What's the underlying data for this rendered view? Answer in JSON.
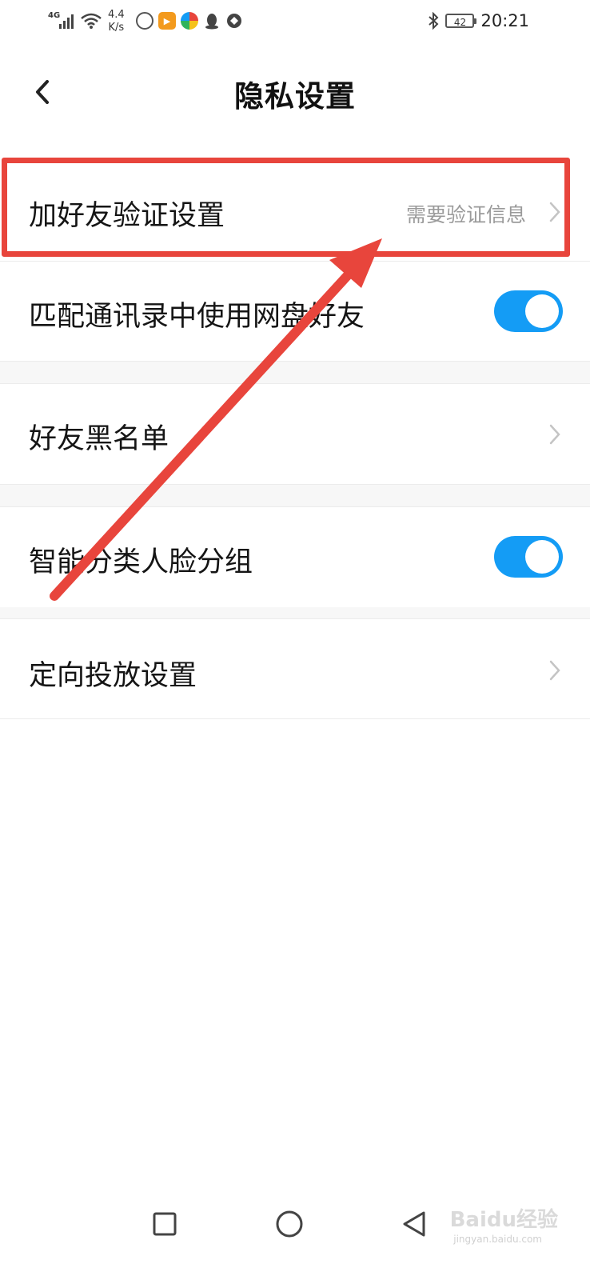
{
  "status_bar": {
    "network": "4G",
    "speed_value": "4.4",
    "speed_unit": "K/s",
    "battery": "42",
    "time": "20:21"
  },
  "header": {
    "title": "隐私设置"
  },
  "settings": {
    "friend_verification": {
      "label": "加好友验证设置",
      "value": "需要验证信息"
    },
    "match_contacts": {
      "label": "匹配通讯录中使用网盘好友",
      "enabled": true
    },
    "blacklist": {
      "label": "好友黑名单"
    },
    "face_grouping": {
      "label": "智能分类人脸分组",
      "enabled": true
    },
    "targeted_ads": {
      "label": "定向投放设置"
    }
  },
  "watermark": {
    "brand": "Baidu经验",
    "url": "jingyan.baidu.com"
  },
  "colors": {
    "accent": "#149cf5",
    "annotation": "#e8453c",
    "secondary_text": "#9a9a9a"
  }
}
